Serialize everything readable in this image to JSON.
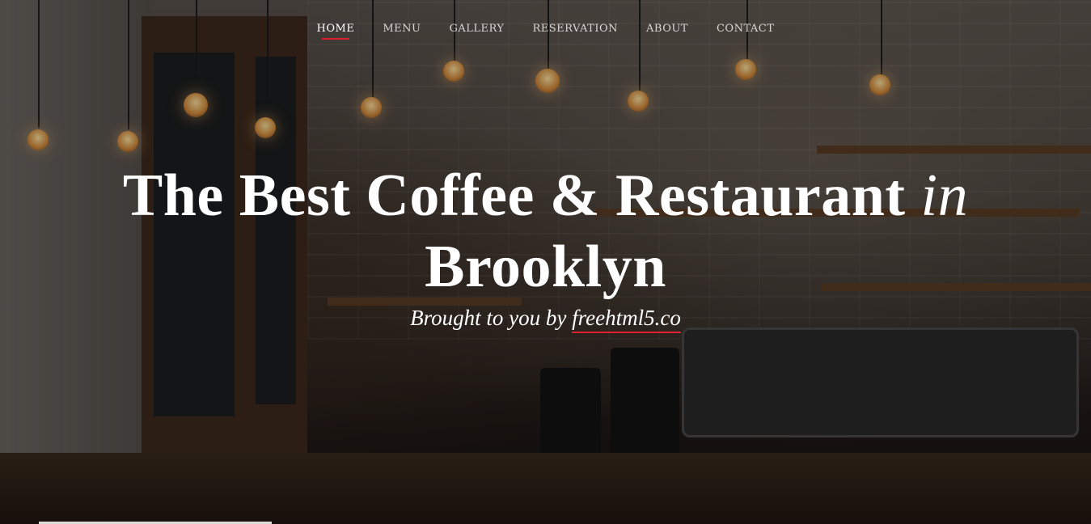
{
  "nav": {
    "items": [
      {
        "label": "HOME",
        "active": true
      },
      {
        "label": "MENU",
        "active": false
      },
      {
        "label": "GALLERY",
        "active": false
      },
      {
        "label": "RESERVATION",
        "active": false
      },
      {
        "label": "ABOUT",
        "active": false
      },
      {
        "label": "CONTACT",
        "active": false
      }
    ],
    "active_underline_color": "#e0202d"
  },
  "hero": {
    "headline_main": "The Best Coffee & Restaurant",
    "headline_italic": "in",
    "headline_line2": "Brooklyn",
    "tagline_prefix": "Brought to you by",
    "tagline_link": "freehtml5.co",
    "background_description_icon": "coffee-shop-photo"
  }
}
